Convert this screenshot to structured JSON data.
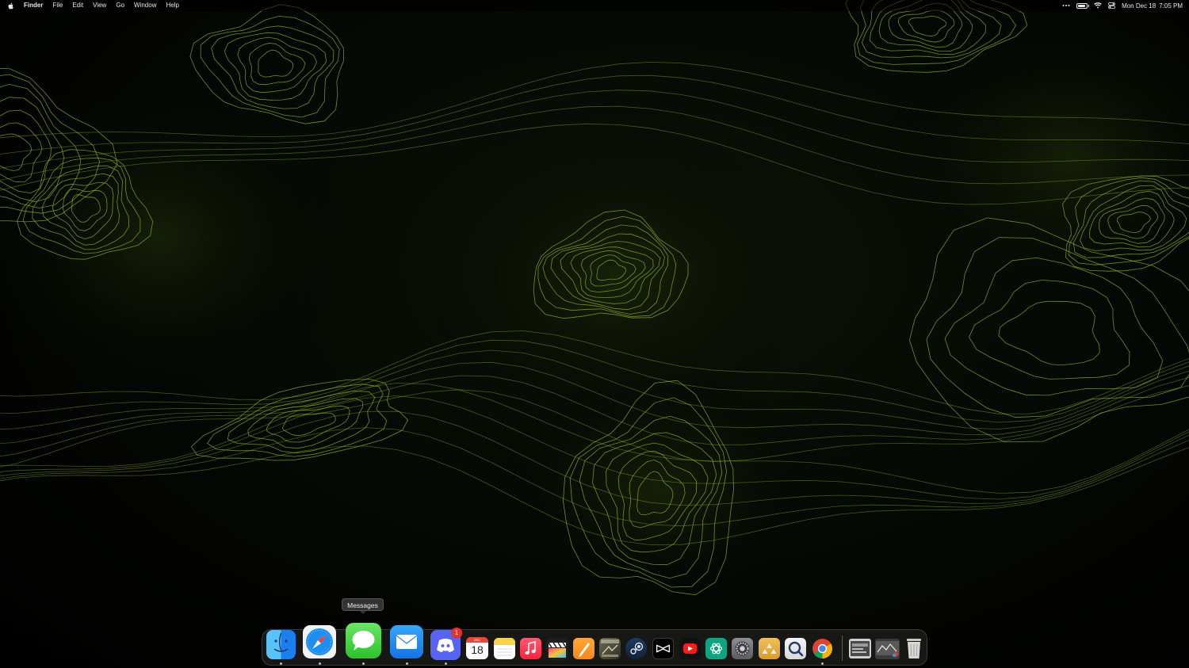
{
  "menubar": {
    "apple_icon": "apple-logo",
    "app_name": "Finder",
    "menus": [
      "File",
      "Edit",
      "View",
      "Go",
      "Window",
      "Help"
    ],
    "status_icons": [
      "more-dots-icon",
      "battery-icon",
      "wifi-icon",
      "control-center-icon"
    ],
    "date": "Mon Dec 18",
    "time": "7:05 PM"
  },
  "tooltip": {
    "text": "Messages"
  },
  "dock": {
    "apps": [
      {
        "name": "Finder",
        "icon": "finder-icon",
        "running": true
      },
      {
        "name": "Safari",
        "icon": "safari-icon",
        "running": true
      },
      {
        "name": "Messages",
        "icon": "messages-icon",
        "running": true
      },
      {
        "name": "Mail",
        "icon": "mail-icon",
        "running": true
      },
      {
        "name": "Discord",
        "icon": "discord-icon",
        "running": true,
        "badge": "1"
      },
      {
        "name": "Calendar",
        "icon": "calendar-icon",
        "running": false,
        "month": "DEC",
        "day": "18"
      },
      {
        "name": "Notes",
        "icon": "notes-icon",
        "running": false
      },
      {
        "name": "Music",
        "icon": "music-icon",
        "running": false
      },
      {
        "name": "Final Cut Pro",
        "icon": "final-cut-icon",
        "running": false
      },
      {
        "name": "Pages",
        "icon": "pages-icon",
        "running": false
      },
      {
        "name": "Game",
        "icon": "game-icon",
        "running": false
      },
      {
        "name": "Steam",
        "icon": "steam-icon",
        "running": false
      },
      {
        "name": "CapCut",
        "icon": "capcut-icon",
        "running": false
      },
      {
        "name": "YouTube",
        "icon": "youtube-icon",
        "running": false
      },
      {
        "name": "ChatGPT",
        "icon": "chatgpt-icon",
        "running": false
      },
      {
        "name": "System Settings",
        "icon": "settings-icon",
        "running": false
      },
      {
        "name": "Folder",
        "icon": "folder-icon",
        "running": false
      },
      {
        "name": "Proxyman",
        "icon": "proxy-icon",
        "running": false
      },
      {
        "name": "Google Chrome",
        "icon": "chrome-icon",
        "running": true
      }
    ],
    "stacks": [
      {
        "name": "Downloads",
        "icon": "downloads-stack-icon"
      },
      {
        "name": "Documents",
        "icon": "documents-stack-icon"
      },
      {
        "name": "Trash",
        "icon": "trash-icon"
      }
    ]
  },
  "colors": {
    "contour": "#9ab81c",
    "menubar_text": "#e9e9e9",
    "badge": "#e5322d"
  }
}
